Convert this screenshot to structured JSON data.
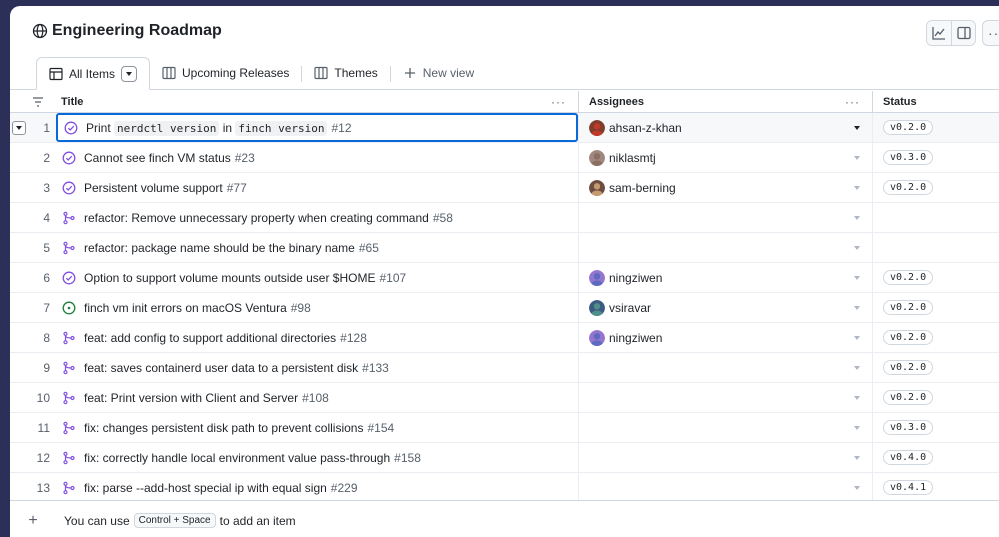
{
  "header": {
    "title": "Engineering Roadmap",
    "more_label": "···"
  },
  "tabs": [
    {
      "label": "All Items",
      "icon": "table-icon",
      "active": true
    },
    {
      "label": "Upcoming Releases",
      "icon": "board-icon",
      "active": false
    },
    {
      "label": "Themes",
      "icon": "board-icon",
      "active": false
    }
  ],
  "new_view_label": "New view",
  "columns": {
    "title": "Title",
    "assignees": "Assignees",
    "status": "Status",
    "menu": "···"
  },
  "rows": [
    {
      "num": "1",
      "type": "issue-closed",
      "pre": "Print ",
      "code1": "nerdctl version",
      "mid": " in ",
      "code2": "finch version",
      "issue": "#12",
      "assignee": "ahsan-z-khan",
      "status": "v0.2.0"
    },
    {
      "num": "2",
      "type": "issue-closed",
      "title": "Cannot see finch VM status",
      "issue": "#23",
      "assignee": "niklasmtj",
      "status": "v0.3.0"
    },
    {
      "num": "3",
      "type": "issue-closed",
      "title": "Persistent volume support",
      "issue": "#77",
      "assignee": "sam-berning",
      "status": "v0.2.0"
    },
    {
      "num": "4",
      "type": "pr",
      "title": "refactor: Remove unnecessary property when creating command",
      "issue": "#58",
      "assignee": "",
      "status": ""
    },
    {
      "num": "5",
      "type": "pr",
      "title": "refactor: package name should be the binary name",
      "issue": "#65",
      "assignee": "",
      "status": ""
    },
    {
      "num": "6",
      "type": "issue-closed",
      "title": "Option to support volume mounts outside user $HOME",
      "issue": "#107",
      "assignee": "ningziwen",
      "status": "v0.2.0"
    },
    {
      "num": "7",
      "type": "issue-open",
      "title": "finch vm init errors on macOS Ventura",
      "issue": "#98",
      "assignee": "vsiravar",
      "status": "v0.2.0"
    },
    {
      "num": "8",
      "type": "pr",
      "title": "feat: add config to support additional directories",
      "issue": "#128",
      "assignee": "ningziwen",
      "status": "v0.2.0"
    },
    {
      "num": "9",
      "type": "pr",
      "title": "feat: saves containerd user data to a persistent disk",
      "issue": "#133",
      "assignee": "",
      "status": "v0.2.0"
    },
    {
      "num": "10",
      "type": "pr",
      "title": "feat: Print version with Client and Server",
      "issue": "#108",
      "assignee": "",
      "status": "v0.2.0"
    },
    {
      "num": "11",
      "type": "pr",
      "title": "fix: changes persistent disk path to prevent collisions",
      "issue": "#154",
      "assignee": "",
      "status": "v0.3.0"
    },
    {
      "num": "12",
      "type": "pr",
      "title": "fix: correctly handle local environment value pass-through",
      "issue": "#158",
      "assignee": "",
      "status": "v0.4.0"
    },
    {
      "num": "13",
      "type": "pr",
      "title": "fix: parse --add-host special ip with equal sign",
      "issue": "#229",
      "assignee": "",
      "status": "v0.4.1"
    }
  ],
  "footer": {
    "plus": "+",
    "hint_pre": "You can use",
    "shortcut": "Control + Space",
    "hint_post": "to add an item"
  },
  "colors": {
    "issue_closed": "#8250df",
    "issue_open": "#1a7f37",
    "pr": "#8250df",
    "accent": "#0969da",
    "backdrop": "#2c2f57"
  }
}
